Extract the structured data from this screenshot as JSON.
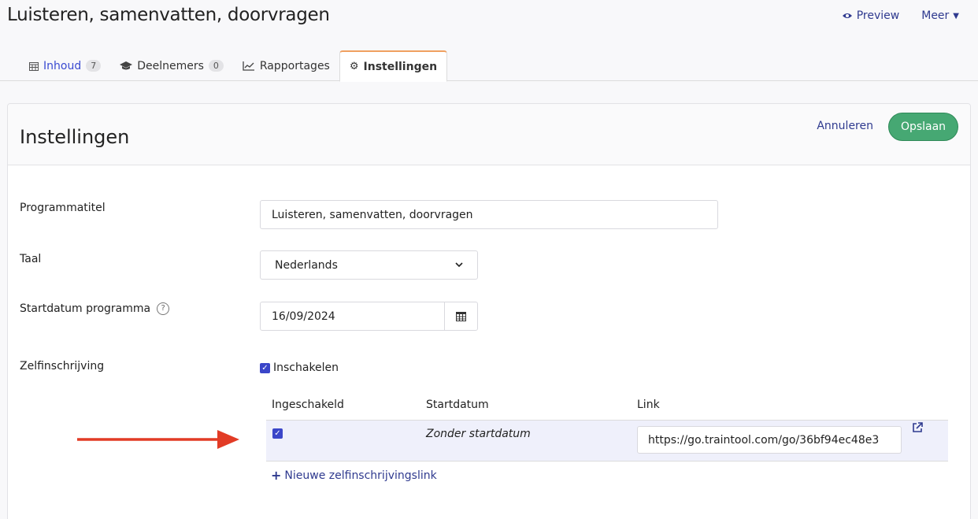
{
  "page_title": "Luisteren, samenvatten, doorvragen",
  "top_actions": {
    "preview": "Preview",
    "more": "Meer"
  },
  "tabs": [
    {
      "label": "Inhoud",
      "count": "7"
    },
    {
      "label": "Deelnemers",
      "count": "0"
    },
    {
      "label": "Rapportages"
    },
    {
      "label": "Instellingen"
    }
  ],
  "settings": {
    "title": "Instellingen",
    "cancel": "Annuleren",
    "save": "Opslaan",
    "program_title_label": "Programmatitel",
    "program_title_value": "Luisteren, samenvatten, doorvragen",
    "language_label": "Taal",
    "language_value": "Nederlands",
    "start_date_label": "Startdatum programma",
    "start_date_value": "16/09/2024",
    "self_enroll_label": "Zelfinschrijving",
    "self_enroll_enable": "Inschakelen",
    "table": {
      "headers": [
        "Ingeschakeld",
        "Startdatum",
        "Link"
      ],
      "rows": [
        {
          "start": "Zonder startdatum",
          "link": "https://go.traintool.com/go/36bf94ec48e3"
        }
      ]
    },
    "new_link": "Nieuwe zelfinschrijvingslink"
  },
  "colors": {
    "accent": "#3b46c9",
    "save": "#46a873",
    "arrow": "#e23b25",
    "active_tab": "#f0a060"
  }
}
